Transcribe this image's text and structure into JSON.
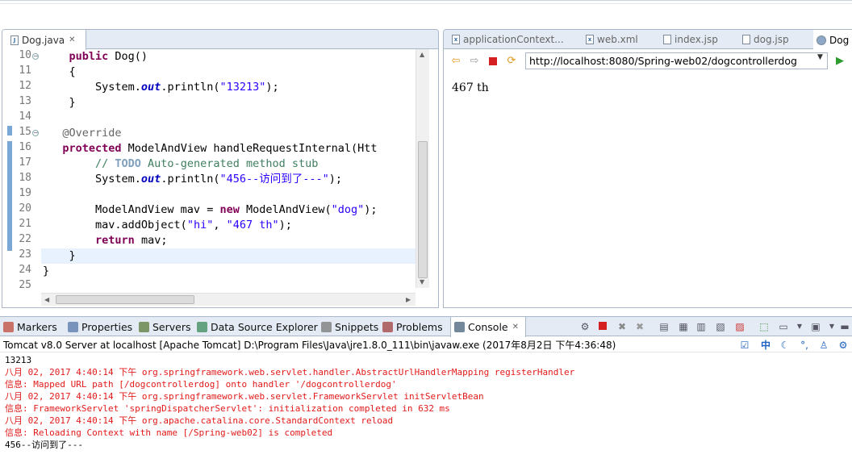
{
  "editor": {
    "tab_label": "Dog.java",
    "tab_icon": "java-file-icon",
    "lines": [
      {
        "num": "10",
        "fold": true,
        "html_parts": [
          [
            "kw",
            "    public "
          ],
          [
            "",
            "Dog()"
          ]
        ]
      },
      {
        "num": "11",
        "parts": [
          [
            "",
            "    {"
          ]
        ]
      },
      {
        "num": "12",
        "parts": [
          [
            "",
            "        System."
          ],
          [
            "fld",
            "out"
          ],
          [
            "",
            ".println("
          ],
          [
            "str",
            "\"13213\""
          ],
          [
            "",
            ");"
          ]
        ]
      },
      {
        "num": "13",
        "parts": [
          [
            "",
            "    }"
          ]
        ]
      },
      {
        "num": "14",
        "parts": [
          [
            "",
            ""
          ]
        ]
      },
      {
        "num": "15",
        "fold": true,
        "parts": [
          [
            "ann",
            "   @Override"
          ]
        ]
      },
      {
        "num": "16",
        "parts": [
          [
            "kw",
            "   protected "
          ],
          [
            "",
            "ModelAndView handleRequestInternal(Htt"
          ]
        ]
      },
      {
        "num": "17",
        "parts": [
          [
            "com",
            "        // "
          ],
          [
            "todo",
            "TODO"
          ],
          [
            "com",
            " Auto-generated method stub"
          ]
        ]
      },
      {
        "num": "18",
        "parts": [
          [
            "",
            "        System."
          ],
          [
            "fld",
            "out"
          ],
          [
            "",
            ".println("
          ],
          [
            "str",
            "\"456--访问到了---\""
          ],
          [
            "",
            ");"
          ]
        ]
      },
      {
        "num": "19",
        "parts": [
          [
            "",
            ""
          ]
        ]
      },
      {
        "num": "20",
        "parts": [
          [
            "",
            "        ModelAndView mav = "
          ],
          [
            "kw",
            "new "
          ],
          [
            "",
            "ModelAndView("
          ],
          [
            "str",
            "\"dog\""
          ],
          [
            "",
            ");"
          ]
        ]
      },
      {
        "num": "21",
        "parts": [
          [
            "",
            "        mav.addObject("
          ],
          [
            "str",
            "\"hi\""
          ],
          [
            "",
            ", "
          ],
          [
            "str",
            "\"467 th\""
          ],
          [
            "",
            ");"
          ]
        ]
      },
      {
        "num": "22",
        "parts": [
          [
            "",
            "        "
          ],
          [
            "kw",
            "return "
          ],
          [
            "",
            "mav;"
          ]
        ]
      },
      {
        "num": "23",
        "parts": [
          [
            "",
            "    }"
          ]
        ]
      },
      {
        "num": "24",
        "parts": [
          [
            "",
            "}"
          ]
        ]
      },
      {
        "num": "25",
        "parts": [
          [
            "",
            ""
          ]
        ]
      }
    ]
  },
  "browser": {
    "tabs": [
      {
        "label": "applicationContext...",
        "icon": "xml-file-icon"
      },
      {
        "label": "web.xml",
        "icon": "xml-file-icon"
      },
      {
        "label": "index.jsp",
        "icon": "jsp-file-icon"
      },
      {
        "label": "dog.jsp",
        "icon": "jsp-file-icon"
      },
      {
        "label": "Dog",
        "icon": "globe-icon"
      }
    ],
    "url": "http://localhost:8080/Spring-web02/dogcontrollerdog",
    "page_text": "467 th"
  },
  "console": {
    "tabs": [
      {
        "label": "Markers",
        "icon": "markers-icon",
        "color": "#c04a3a"
      },
      {
        "label": "Properties",
        "icon": "properties-icon",
        "color": "#5577aa"
      },
      {
        "label": "Servers",
        "icon": "servers-icon",
        "color": "#5a7a3a"
      },
      {
        "label": "Data Source Explorer",
        "icon": "datasource-icon",
        "color": "#3a8a5a"
      },
      {
        "label": "Snippets",
        "icon": "snippets-icon",
        "color": "#777777"
      },
      {
        "label": "Problems",
        "icon": "problems-icon",
        "color": "#a04040"
      },
      {
        "label": "Console",
        "icon": "console-icon",
        "color": "#44607a"
      }
    ],
    "header": "Tomcat v8.0 Server at localhost [Apache Tomcat] D:\\Program Files\\Java\\jre1.8.0_111\\bin\\javaw.exe (2017年8月2日 下午4:36:48)",
    "lines": [
      {
        "text": "13213",
        "color": "black"
      },
      {
        "text": "八月 02, 2017 4:40:14 下午 org.springframework.web.servlet.handler.AbstractUrlHandlerMapping registerHandler",
        "color": "red"
      },
      {
        "text": "信息: Mapped URL path [/dogcontrollerdog] onto handler '/dogcontrollerdog'",
        "color": "red"
      },
      {
        "text": "八月 02, 2017 4:40:14 下午 org.springframework.web.servlet.FrameworkServlet initServletBean",
        "color": "red"
      },
      {
        "text": "信息: FrameworkServlet 'springDispatcherServlet': initialization completed in 632 ms",
        "color": "red"
      },
      {
        "text": "八月 02, 2017 4:40:14 下午 org.apache.catalina.core.StandardContext reload",
        "color": "red"
      },
      {
        "text": "信息: Reloading Context with name [/Spring-web02] is completed",
        "color": "red"
      },
      {
        "text": "456--访问到了---",
        "color": "black"
      }
    ]
  }
}
